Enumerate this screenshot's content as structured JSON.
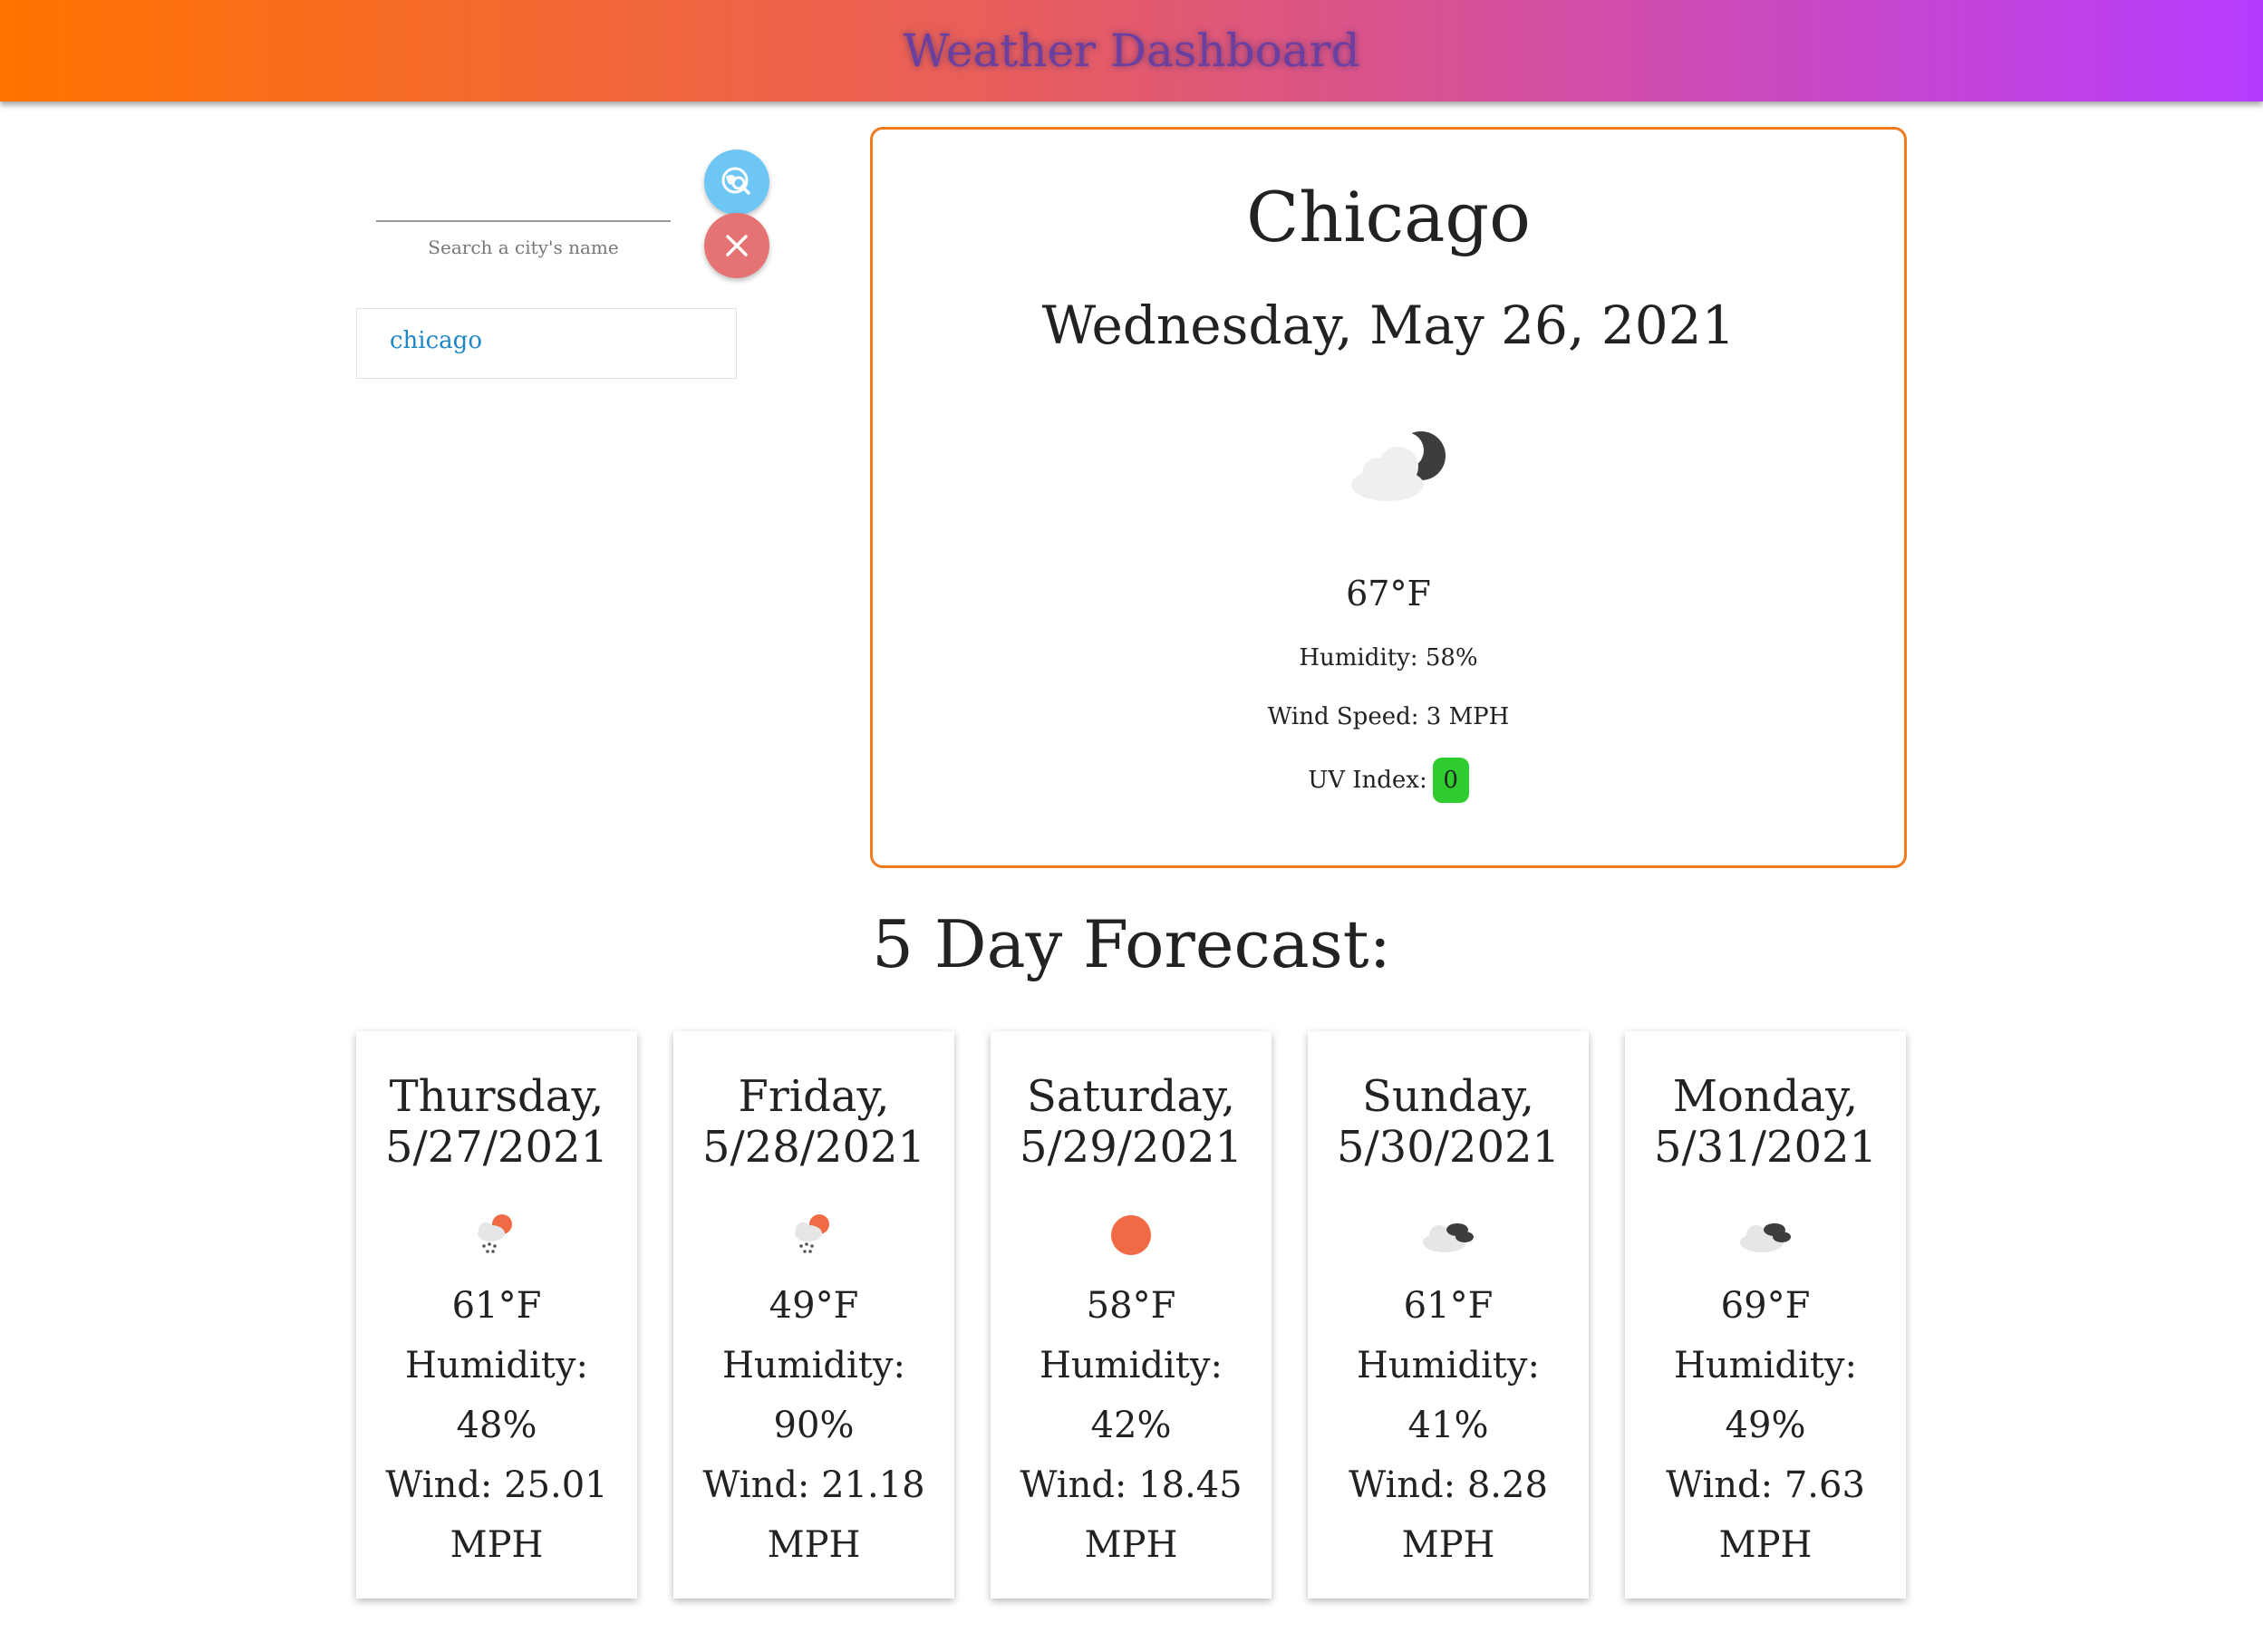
{
  "header": {
    "title": "Weather Dashboard"
  },
  "colors": {
    "header_gradient_start": "#ff7300",
    "header_gradient_end": "#b63bff",
    "card_border": "#f07a1c",
    "search_button": "#6ec6f5",
    "clear_button": "#e57373",
    "uv_low": "#2ecc2e",
    "history_link": "#1e88c7"
  },
  "search": {
    "value": "",
    "label": "Search a city's name",
    "search_icon": "globe-search-icon",
    "clear_icon": "close-icon"
  },
  "history": {
    "items": [
      "chicago"
    ]
  },
  "current": {
    "city": "Chicago",
    "date": "Wednesday, May 26, 2021",
    "icon": "cloud-night-icon",
    "temp": "67°F",
    "humidity": "Humidity: 58%",
    "wind": "Wind Speed: 3 MPH",
    "uv_label": "UV Index:",
    "uv_value": "0"
  },
  "forecast": {
    "title": "5 Day Forecast:",
    "days": [
      {
        "day": "Thursday,",
        "date": "5/27/2021",
        "icon": "rain-sun-icon",
        "temp": "61°F",
        "humidity_label": "Humidity:",
        "humidity": "48%",
        "wind_label": "Wind: 25.01",
        "wind_unit": "MPH"
      },
      {
        "day": "Friday,",
        "date": "5/28/2021",
        "icon": "rain-sun-icon",
        "temp": "49°F",
        "humidity_label": "Humidity:",
        "humidity": "90%",
        "wind_label": "Wind: 21.18",
        "wind_unit": "MPH"
      },
      {
        "day": "Saturday,",
        "date": "5/29/2021",
        "icon": "sun-icon",
        "temp": "58°F",
        "humidity_label": "Humidity:",
        "humidity": "42%",
        "wind_label": "Wind: 18.45",
        "wind_unit": "MPH"
      },
      {
        "day": "Sunday,",
        "date": "5/30/2021",
        "icon": "broken-clouds-icon",
        "temp": "61°F",
        "humidity_label": "Humidity:",
        "humidity": "41%",
        "wind_label": "Wind: 8.28",
        "wind_unit": "MPH"
      },
      {
        "day": "Monday,",
        "date": "5/31/2021",
        "icon": "broken-clouds-icon",
        "temp": "69°F",
        "humidity_label": "Humidity:",
        "humidity": "49%",
        "wind_label": "Wind: 7.63",
        "wind_unit": "MPH"
      }
    ]
  }
}
